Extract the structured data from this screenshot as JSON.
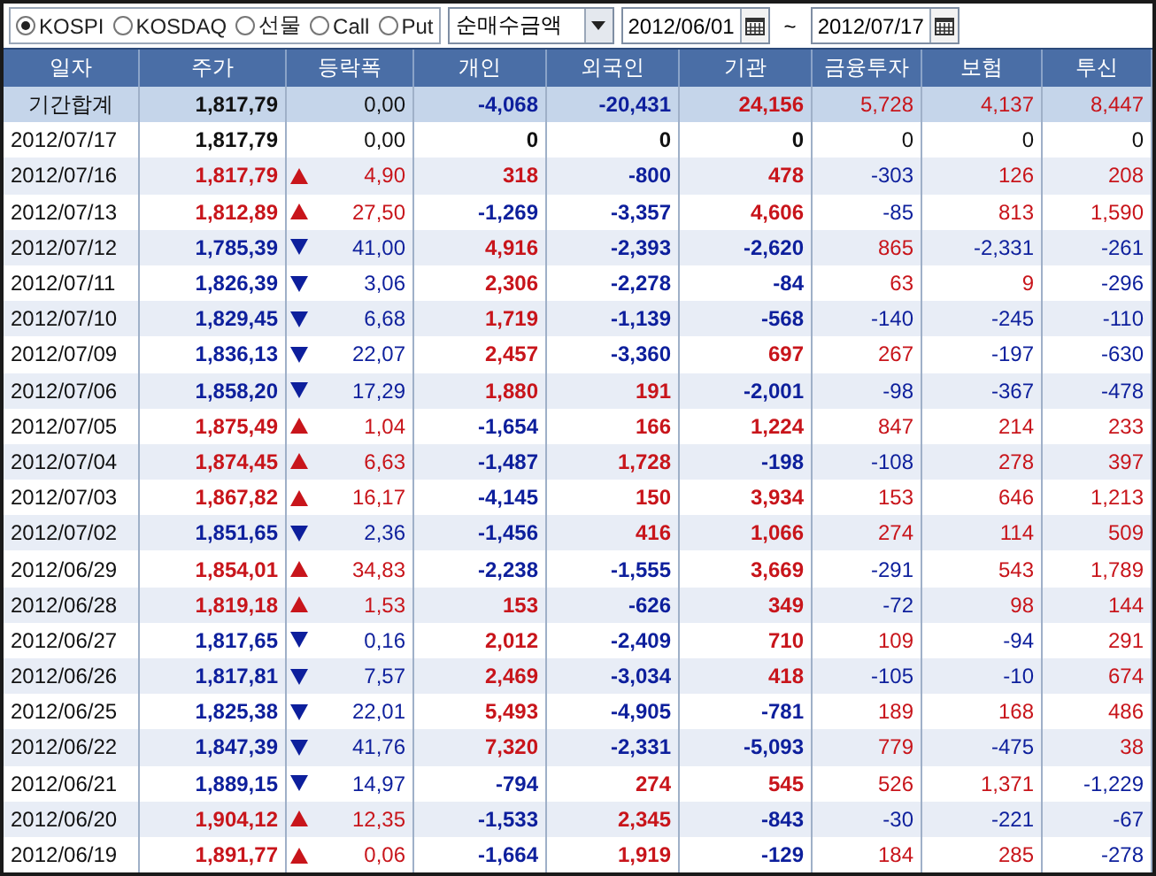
{
  "toolbar": {
    "markets": [
      {
        "label": "KOSPI",
        "selected": true
      },
      {
        "label": "KOSDAQ",
        "selected": false
      },
      {
        "label": "선물",
        "selected": false
      },
      {
        "label": "Call",
        "selected": false
      },
      {
        "label": "Put",
        "selected": false
      }
    ],
    "measure": {
      "value": "순매수금액"
    },
    "date_from": {
      "value": "2012/06/01"
    },
    "range_separator": "~",
    "date_to": {
      "value": "2012/07/17"
    }
  },
  "table": {
    "columns": [
      "일자",
      "주가",
      "등락폭",
      "개인",
      "외국인",
      "기관",
      "금융투자",
      "보험",
      "투신"
    ],
    "rows": [
      {
        "kind": "summary",
        "rising": false,
        "falling": false,
        "cells": [
          "기간합계",
          "1,817,79",
          "0,00",
          "-4,068",
          "-20,431",
          "24,156",
          "5,728",
          "4,137",
          "8,447"
        ]
      },
      {
        "kind": "day",
        "rising": false,
        "falling": false,
        "cells": [
          "2012/07/17",
          "1,817,79",
          "0,00",
          "0",
          "0",
          "0",
          "0",
          "0",
          "0"
        ]
      },
      {
        "kind": "day",
        "rising": true,
        "falling": false,
        "cells": [
          "2012/07/16",
          "1,817,79",
          "4,90",
          "318",
          "-800",
          "478",
          "-303",
          "126",
          "208"
        ]
      },
      {
        "kind": "day",
        "rising": true,
        "falling": false,
        "cells": [
          "2012/07/13",
          "1,812,89",
          "27,50",
          "-1,269",
          "-3,357",
          "4,606",
          "-85",
          "813",
          "1,590"
        ]
      },
      {
        "kind": "day",
        "rising": false,
        "falling": true,
        "cells": [
          "2012/07/12",
          "1,785,39",
          "41,00",
          "4,916",
          "-2,393",
          "-2,620",
          "865",
          "-2,331",
          "-261"
        ]
      },
      {
        "kind": "day",
        "rising": false,
        "falling": true,
        "cells": [
          "2012/07/11",
          "1,826,39",
          "3,06",
          "2,306",
          "-2,278",
          "-84",
          "63",
          "9",
          "-296"
        ]
      },
      {
        "kind": "day",
        "rising": false,
        "falling": true,
        "cells": [
          "2012/07/10",
          "1,829,45",
          "6,68",
          "1,719",
          "-1,139",
          "-568",
          "-140",
          "-245",
          "-110"
        ]
      },
      {
        "kind": "day",
        "rising": false,
        "falling": true,
        "cells": [
          "2012/07/09",
          "1,836,13",
          "22,07",
          "2,457",
          "-3,360",
          "697",
          "267",
          "-197",
          "-630"
        ]
      },
      {
        "kind": "day",
        "rising": false,
        "falling": true,
        "cells": [
          "2012/07/06",
          "1,858,20",
          "17,29",
          "1,880",
          "191",
          "-2,001",
          "-98",
          "-367",
          "-478"
        ]
      },
      {
        "kind": "day",
        "rising": true,
        "falling": false,
        "cells": [
          "2012/07/05",
          "1,875,49",
          "1,04",
          "-1,654",
          "166",
          "1,224",
          "847",
          "214",
          "233"
        ]
      },
      {
        "kind": "day",
        "rising": true,
        "falling": false,
        "cells": [
          "2012/07/04",
          "1,874,45",
          "6,63",
          "-1,487",
          "1,728",
          "-198",
          "-108",
          "278",
          "397"
        ]
      },
      {
        "kind": "day",
        "rising": true,
        "falling": false,
        "cells": [
          "2012/07/03",
          "1,867,82",
          "16,17",
          "-4,145",
          "150",
          "3,934",
          "153",
          "646",
          "1,213"
        ]
      },
      {
        "kind": "day",
        "rising": false,
        "falling": true,
        "cells": [
          "2012/07/02",
          "1,851,65",
          "2,36",
          "-1,456",
          "416",
          "1,066",
          "274",
          "114",
          "509"
        ]
      },
      {
        "kind": "day",
        "rising": true,
        "falling": false,
        "cells": [
          "2012/06/29",
          "1,854,01",
          "34,83",
          "-2,238",
          "-1,555",
          "3,669",
          "-291",
          "543",
          "1,789"
        ]
      },
      {
        "kind": "day",
        "rising": true,
        "falling": false,
        "cells": [
          "2012/06/28",
          "1,819,18",
          "1,53",
          "153",
          "-626",
          "349",
          "-72",
          "98",
          "144"
        ]
      },
      {
        "kind": "day",
        "rising": false,
        "falling": true,
        "cells": [
          "2012/06/27",
          "1,817,65",
          "0,16",
          "2,012",
          "-2,409",
          "710",
          "109",
          "-94",
          "291"
        ]
      },
      {
        "kind": "day",
        "rising": false,
        "falling": true,
        "cells": [
          "2012/06/26",
          "1,817,81",
          "7,57",
          "2,469",
          "-3,034",
          "418",
          "-105",
          "-10",
          "674"
        ]
      },
      {
        "kind": "day",
        "rising": false,
        "falling": true,
        "cells": [
          "2012/06/25",
          "1,825,38",
          "22,01",
          "5,493",
          "-4,905",
          "-781",
          "189",
          "168",
          "486"
        ]
      },
      {
        "kind": "day",
        "rising": false,
        "falling": true,
        "cells": [
          "2012/06/22",
          "1,847,39",
          "41,76",
          "7,320",
          "-2,331",
          "-5,093",
          "779",
          "-475",
          "38"
        ]
      },
      {
        "kind": "day",
        "rising": false,
        "falling": true,
        "cells": [
          "2012/06/21",
          "1,889,15",
          "14,97",
          "-794",
          "274",
          "545",
          "526",
          "1,371",
          "-1,229"
        ]
      },
      {
        "kind": "day",
        "rising": true,
        "falling": false,
        "cells": [
          "2012/06/20",
          "1,904,12",
          "12,35",
          "-1,533",
          "2,345",
          "-843",
          "-30",
          "-221",
          "-67"
        ]
      },
      {
        "kind": "day",
        "rising": true,
        "falling": false,
        "cells": [
          "2012/06/19",
          "1,891,77",
          "0,06",
          "-1,664",
          "1,919",
          "-129",
          "184",
          "285",
          "-278"
        ]
      }
    ]
  }
}
